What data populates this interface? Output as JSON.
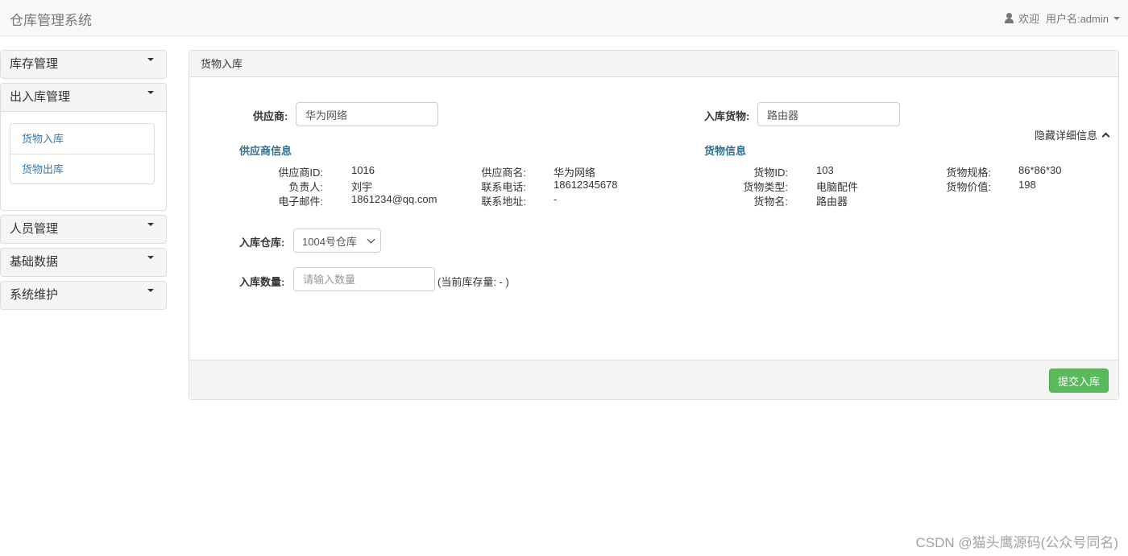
{
  "navbar": {
    "brand": "仓库管理系统",
    "welcome": "欢迎",
    "username": "用户名:admin"
  },
  "sidebar": {
    "groups": [
      {
        "label": "库存管理"
      },
      {
        "label": "出入库管理",
        "items": [
          "货物入库",
          "货物出库"
        ]
      },
      {
        "label": "人员管理"
      },
      {
        "label": "基础数据"
      },
      {
        "label": "系统维护"
      }
    ]
  },
  "panel": {
    "title": "货物入库",
    "supplier_label": "供应商:",
    "supplier_value": "华为网络",
    "goods_label": "入库货物:",
    "goods_value": "路由器",
    "toggle_details": "隐藏详细信息",
    "supplier_info": {
      "title": "供应商信息",
      "id_label": "供应商ID:",
      "id": "1016",
      "name_label": "供应商名:",
      "name": "华为网络",
      "person_label": "负责人:",
      "person": "刘宇",
      "phone_label": "联系电话:",
      "phone": "18612345678",
      "email_label": "电子邮件:",
      "email": "1861234@qq.com",
      "address_label": "联系地址:",
      "address": "-"
    },
    "goods_info": {
      "title": "货物信息",
      "id_label": "货物ID:",
      "id": "103",
      "spec_label": "货物规格:",
      "spec": "86*86*30",
      "type_label": "货物类型:",
      "type": "电脑配件",
      "value_label": "货物价值:",
      "value": "198",
      "name_label": "货物名:",
      "name": "路由器"
    },
    "warehouse_label": "入库仓库:",
    "warehouse_selected": "1004号仓库",
    "quantity_label": "入库数量:",
    "quantity_placeholder": "请输入数量",
    "stock_hint": "(当前库存量: - )",
    "submit_label": "提交入库"
  },
  "watermark": "CSDN @猫头鹰源码(公众号同名)",
  "colors": {
    "accent": "#337ab7",
    "section": "#31708f",
    "submit": "#5cb85c"
  },
  "icons": [
    "user-icon",
    "caret-down-icon",
    "chevron-up-icon"
  ]
}
